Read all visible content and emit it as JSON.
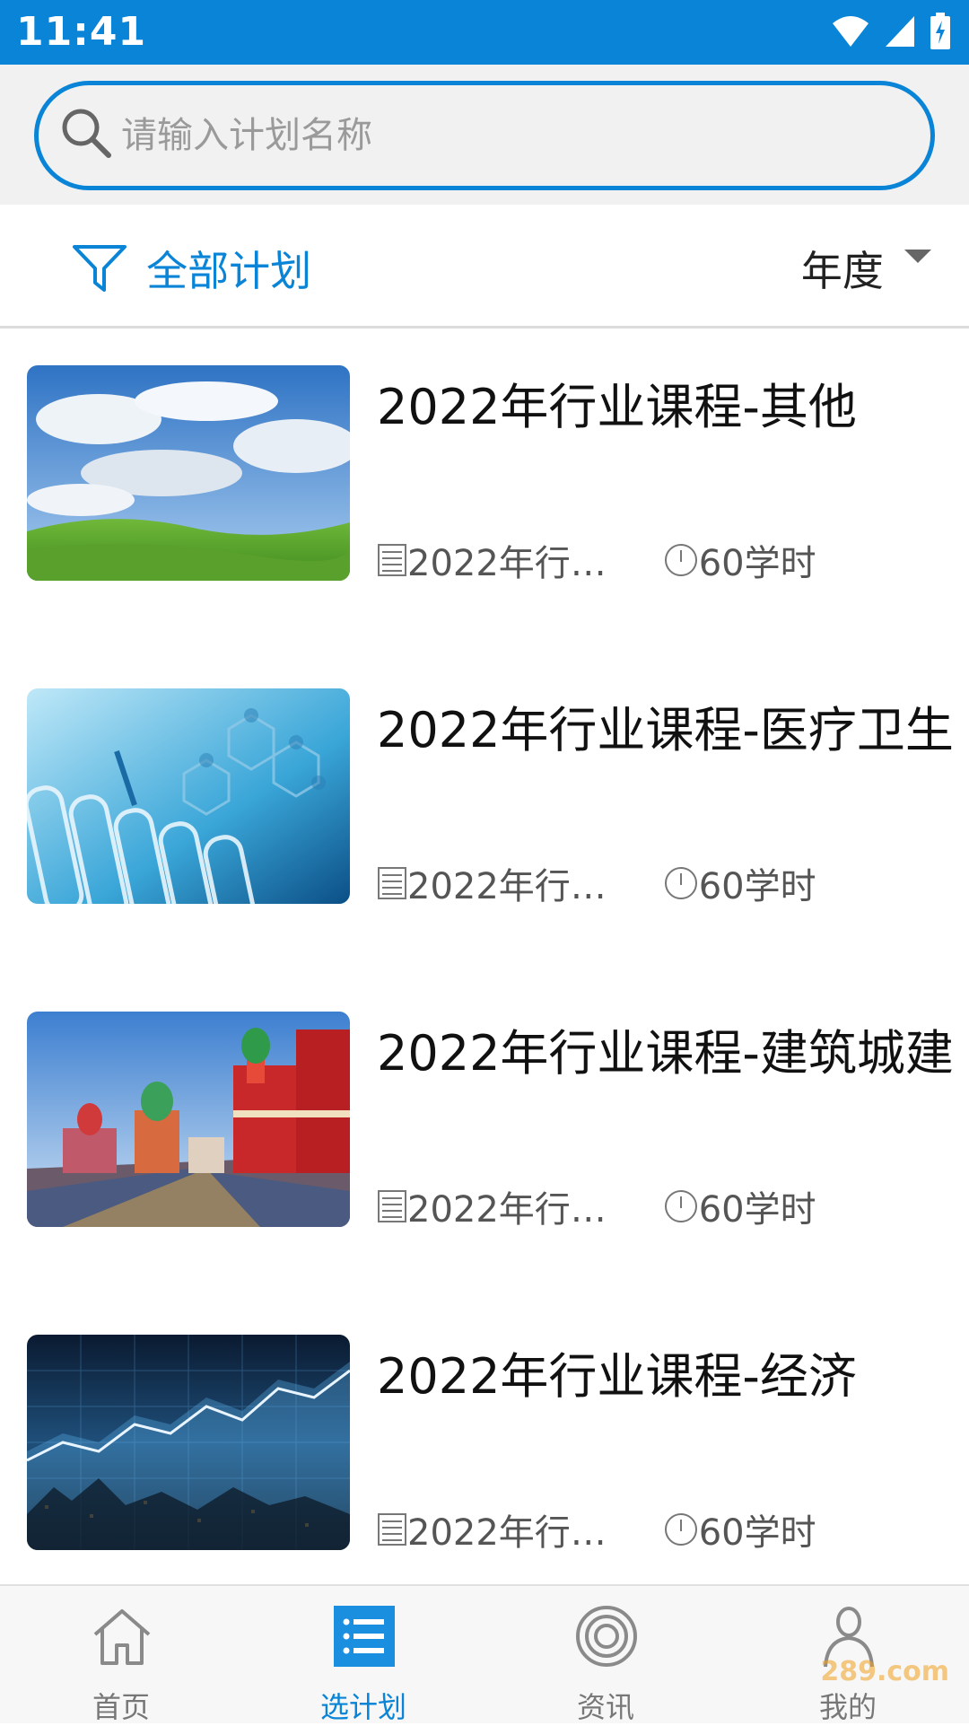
{
  "status_bar": {
    "time": "11:41"
  },
  "search": {
    "placeholder": "请输入计划名称",
    "value": ""
  },
  "filter": {
    "label": "全部计划",
    "year_label": "年度"
  },
  "plans": [
    {
      "title": "2022年行业课程-其他",
      "category": "2022年行业...",
      "hours": "60学时",
      "image": "sky-grassland-photo"
    },
    {
      "title": "2022年行业课程-医疗卫生",
      "category": "2022年行业...",
      "hours": "60学时",
      "image": "lab-test-tubes-photo"
    },
    {
      "title": "2022年行业课程-建筑城建",
      "category": "2022年行业...",
      "hours": "60学时",
      "image": "onion-dome-architecture-photo"
    },
    {
      "title": "2022年行业课程-经济",
      "category": "2022年行业...",
      "hours": "60学时",
      "image": "city-stock-chart-photo"
    }
  ],
  "bottom_nav": [
    {
      "label": "首页",
      "icon": "home-icon",
      "active": false
    },
    {
      "label": "选计划",
      "icon": "list-icon",
      "active": true
    },
    {
      "label": "资讯",
      "icon": "news-icon",
      "active": false
    },
    {
      "label": "我的",
      "icon": "profile-icon",
      "active": false
    }
  ],
  "watermark": "289.com",
  "colors": {
    "primary": "#0a84d6",
    "background": "#ffffff",
    "nav_background": "#f7f7f7"
  }
}
